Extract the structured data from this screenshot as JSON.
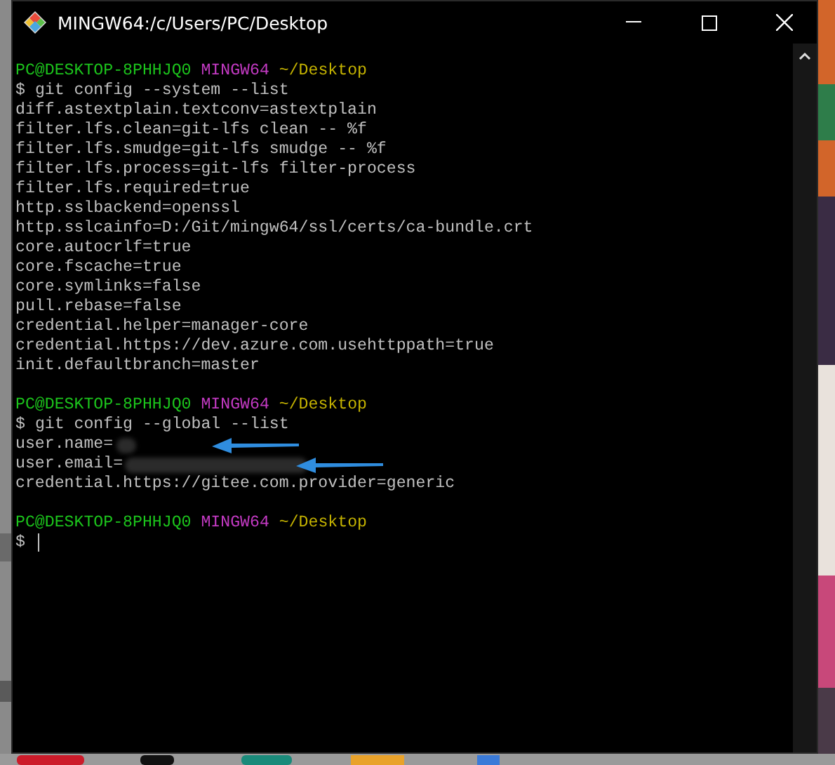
{
  "window": {
    "title": "MINGW64:/c/Users/PC/Desktop"
  },
  "terminal": {
    "lines": [
      {
        "kind": "prompt",
        "user": "PC@DESKTOP-8PHHJQ0",
        "host": "MINGW64",
        "path": "~/Desktop"
      },
      {
        "kind": "command",
        "sign": "$",
        "text": "git config --system --list"
      },
      {
        "kind": "output",
        "text": "diff.astextplain.textconv=astextplain"
      },
      {
        "kind": "output",
        "text": "filter.lfs.clean=git-lfs clean -- %f"
      },
      {
        "kind": "output",
        "text": "filter.lfs.smudge=git-lfs smudge -- %f"
      },
      {
        "kind": "output",
        "text": "filter.lfs.process=git-lfs filter-process"
      },
      {
        "kind": "output",
        "text": "filter.lfs.required=true"
      },
      {
        "kind": "output",
        "text": "http.sslbackend=openssl"
      },
      {
        "kind": "output",
        "text": "http.sslcainfo=D:/Git/mingw64/ssl/certs/ca-bundle.crt"
      },
      {
        "kind": "output",
        "text": "core.autocrlf=true"
      },
      {
        "kind": "output",
        "text": "core.fscache=true"
      },
      {
        "kind": "output",
        "text": "core.symlinks=false"
      },
      {
        "kind": "output",
        "text": "pull.rebase=false"
      },
      {
        "kind": "output",
        "text": "credential.helper=manager-core"
      },
      {
        "kind": "output",
        "text": "credential.https://dev.azure.com.usehttppath=true"
      },
      {
        "kind": "output",
        "text": "init.defaultbranch=master"
      },
      {
        "kind": "blank"
      },
      {
        "kind": "prompt",
        "user": "PC@DESKTOP-8PHHJQ0",
        "host": "MINGW64",
        "path": "~/Desktop"
      },
      {
        "kind": "command",
        "sign": "$",
        "text": "git config --global --list"
      },
      {
        "kind": "redacted",
        "text": "user.name="
      },
      {
        "kind": "redacted",
        "text": "user.email="
      },
      {
        "kind": "output",
        "text": "credential.https://gitee.com.provider=generic"
      },
      {
        "kind": "blank"
      },
      {
        "kind": "prompt",
        "user": "PC@DESKTOP-8PHHJQ0",
        "host": "MINGW64",
        "path": "~/Desktop"
      },
      {
        "kind": "input",
        "sign": "$"
      }
    ]
  }
}
